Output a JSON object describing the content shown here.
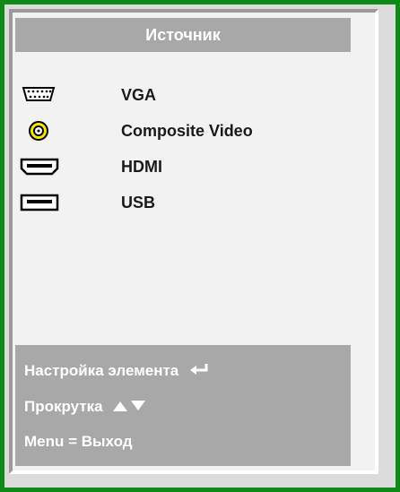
{
  "title": "Источник",
  "sources": [
    {
      "icon": "vga-port-icon",
      "label": "VGA"
    },
    {
      "icon": "composite-video-icon",
      "label": "Composite Video"
    },
    {
      "icon": "hdmi-port-icon",
      "label": "HDMI"
    },
    {
      "icon": "usb-port-icon",
      "label": "USB"
    }
  ],
  "footer": {
    "adjust_label": "Настройка элемента",
    "adjust_icon": "enter-arrow-icon",
    "scroll_label": "Прокрутка",
    "scroll_icons": [
      "arrow-up-icon",
      "arrow-down-icon"
    ],
    "exit_label": "Menu = Выход"
  },
  "colors": {
    "frame_border": "#0f8a18",
    "panel_bar": "#a8a8a8",
    "panel_bg": "#f2f2f2",
    "composite_yellow": "#f5e600"
  }
}
